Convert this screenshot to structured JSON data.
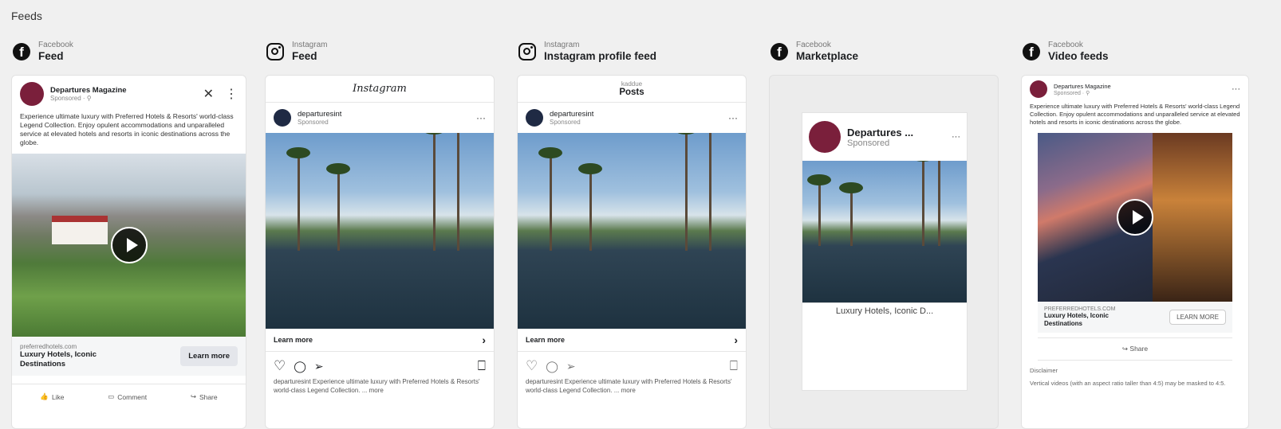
{
  "page": {
    "section_title": "Feeds"
  },
  "columns": [
    {
      "platform": "Facebook",
      "placement": "Feed",
      "icon": "facebook-icon"
    },
    {
      "platform": "Instagram",
      "placement": "Feed",
      "icon": "instagram-icon"
    },
    {
      "platform": "Instagram",
      "placement": "Instagram profile feed",
      "icon": "instagram-icon"
    },
    {
      "platform": "Facebook",
      "placement": "Marketplace",
      "icon": "facebook-icon"
    },
    {
      "platform": "Facebook",
      "placement": "Video feeds",
      "icon": "facebook-icon"
    }
  ],
  "fb_feed": {
    "page_name": "Departures Magazine",
    "sponsored": "Sponsored · ⚲",
    "body": "Experience ultimate luxury with Preferred Hotels & Resorts' world-class Legend Collection. Enjoy opulent accommodations and unparalleled service at elevated hotels and resorts in iconic destinations across the globe.",
    "domain": "preferredhotels.com",
    "headline": "Luxury Hotels, Iconic Destinations",
    "cta": "Learn more",
    "like": "Like",
    "comment": "Comment",
    "share": "Share"
  },
  "ig_feed": {
    "logo": "Instagram",
    "account": "departuresint",
    "sponsored": "Sponsored",
    "cta": "Learn more",
    "caption": "departuresint Experience ultimate luxury with Preferred Hotels & Resorts' world-class Legend Collection. ... more"
  },
  "ig_profile": {
    "username": "kaddue",
    "posts": "Posts",
    "account": "departuresint",
    "sponsored": "Sponsored",
    "cta": "Learn more",
    "caption": "departuresint Experience ultimate luxury with Preferred Hotels & Resorts' world-class Legend Collection. ... more"
  },
  "marketplace": {
    "page_name": "Departures ...",
    "sponsored": "Sponsored",
    "title": "Luxury Hotels, Iconic D..."
  },
  "video_feed": {
    "page_name": "Departures Magazine",
    "sponsored": "Sponsored · ⚲",
    "body": "Experience ultimate luxury with Preferred Hotels & Resorts' world-class Legend Collection. Enjoy opulent accommodations and unparalleled service at elevated hotels and resorts in iconic destinations across the globe.",
    "domain": "PREFERREDHOTELS.COM",
    "headline": "Luxury Hotels, Iconic Destinations",
    "cta": "LEARN MORE",
    "share": "Share",
    "disclaimer_label": "Disclaimer",
    "disclaimer_text": "Vertical videos (with an aspect ratio taller than 4:5) may be masked to 4:5."
  },
  "icons": {
    "close": "✕",
    "more_vertical": "⋮",
    "more_horizontal": "···",
    "chevron": "›",
    "heart": "♡",
    "comment": "◯",
    "send": "➢",
    "save": "⎕",
    "like": "👍",
    "comment_fb": "▭",
    "share": "↪"
  },
  "colors": {
    "brand_avatar": "#7a1f3b",
    "facebook": "#111111"
  }
}
